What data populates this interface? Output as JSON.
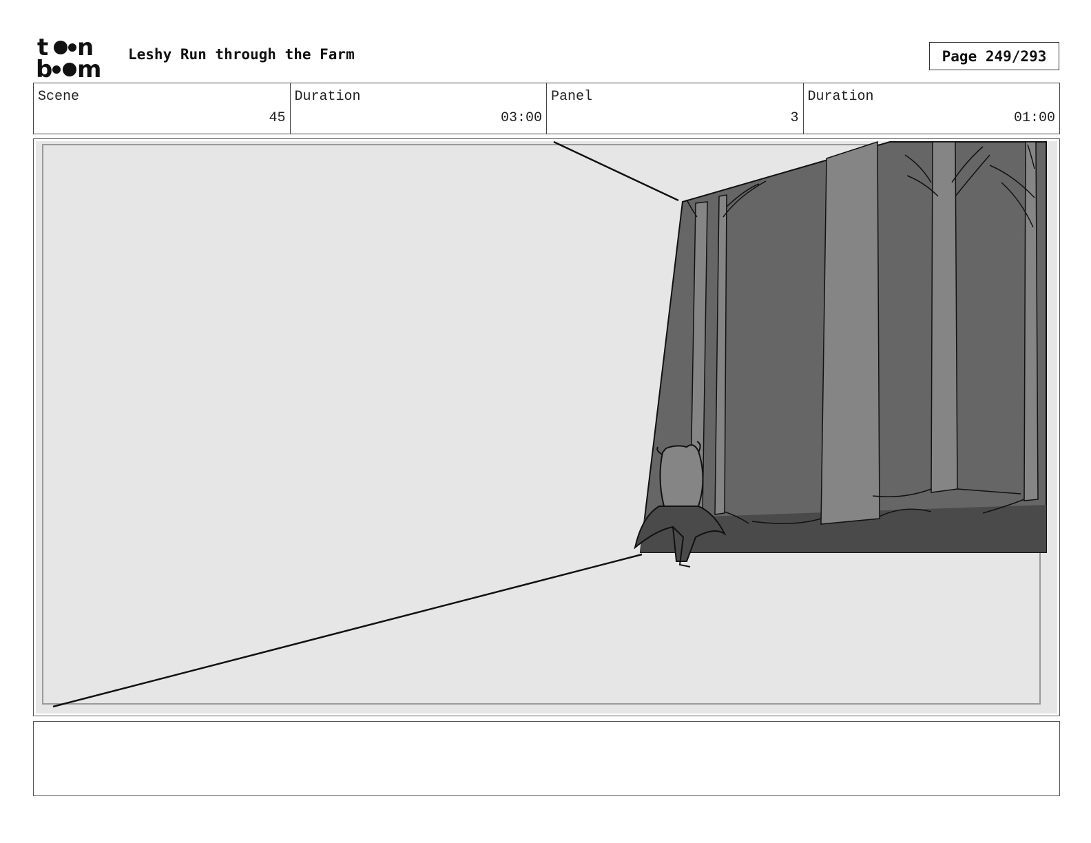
{
  "header": {
    "logo_text_top": "toon",
    "logo_text_bottom": "boom",
    "title": "Leshy Run through the Farm",
    "page": "Page 249/293"
  },
  "info": {
    "scene_label": "Scene",
    "scene_value": "45",
    "duration_label": "Duration",
    "duration_value": "03:00",
    "panel_label": "Panel",
    "panel_value": "3",
    "panel_duration_label": "Duration",
    "panel_duration_value": "01:00"
  },
  "panel": {
    "description": "",
    "colors": {
      "background": "#e6e6e6",
      "forest": "#666666",
      "trunk": "#858585",
      "ground": "#4a4a4a",
      "line": "#111111"
    }
  },
  "notes": {
    "text": ""
  }
}
